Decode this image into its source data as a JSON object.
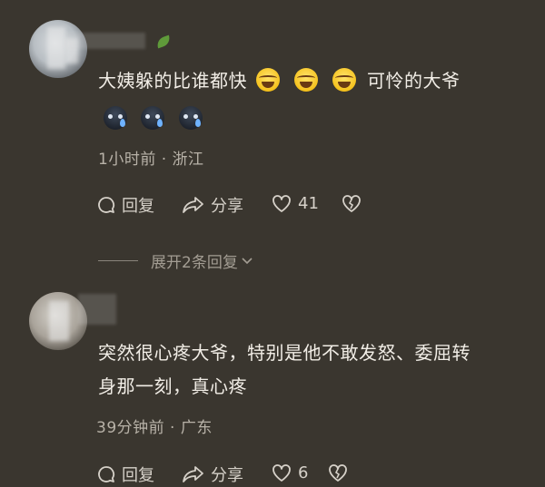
{
  "comments": [
    {
      "text_before": "大姨躲的比谁都快",
      "text_after": "可怜的大爷",
      "emojis": [
        "laugh-cry-emoji",
        "laugh-cry-emoji",
        "laugh-cry-emoji"
      ],
      "sad_emojis": [
        "sad-crying-emoji",
        "sad-crying-emoji",
        "sad-crying-emoji"
      ],
      "meta": "1小时前 · 浙江",
      "reply_label": "回复",
      "share_label": "分享",
      "likes": "41"
    },
    {
      "text_line1": "突然很心疼大爷，特别是他不敢发怒、委屈转",
      "text_line2": "身那一刻，真心疼",
      "meta": "39分钟前 · 广东",
      "reply_label": "回复",
      "share_label": "分享",
      "likes": "6"
    }
  ],
  "expand_replies": "展开2条回复"
}
